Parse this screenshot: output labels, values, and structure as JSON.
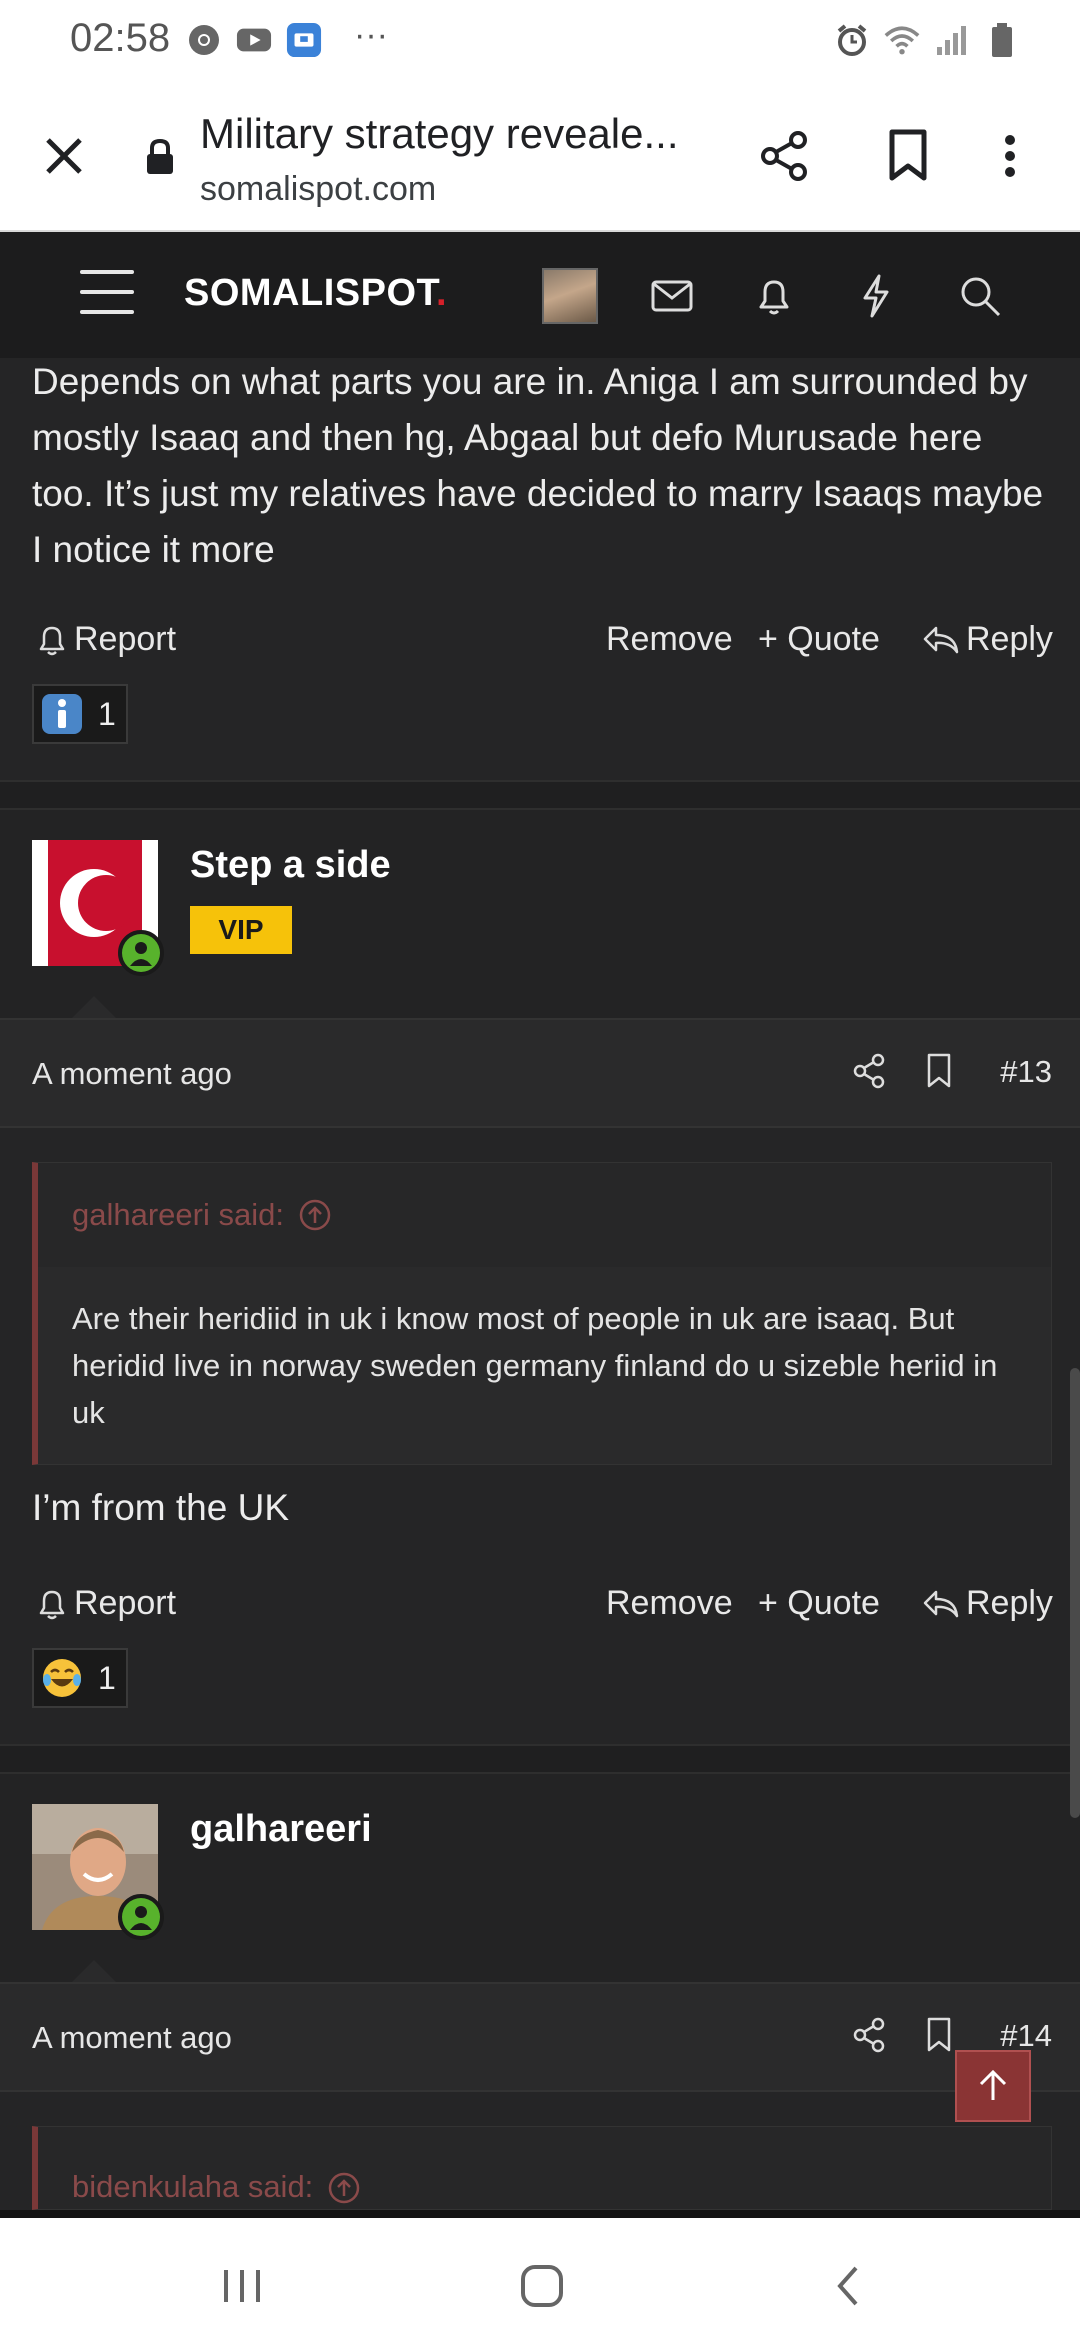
{
  "status_bar": {
    "time": "02:58",
    "more": "···"
  },
  "browser": {
    "title": "Military strategy reveale...",
    "url": "somalispot.com"
  },
  "site": {
    "logo": "SOMALISPOT",
    "logo_dot": "."
  },
  "post12": {
    "text": "Depends on what parts you are in. Aniga I am surrounded by mostly Isaaq and then hg, Abgaal but defo Murusade here too. It’s just my relatives have decided to marry Isaaqs maybe I notice it more",
    "reaction_count": "1"
  },
  "actions": {
    "report": "Report",
    "remove": "Remove",
    "quote": "+ Quote",
    "reply": "Reply"
  },
  "post13": {
    "username": "Step a side",
    "badge": "VIP",
    "time": "A moment ago",
    "number": "#13",
    "quote_author": "galhareeri said:",
    "quote_text": "Are their heridiid in uk i know most of people in uk are isaaq. But heridid live in norway sweden germany finland do u sizeble heriid in uk",
    "text": "I’m from the UK",
    "reaction_count": "1"
  },
  "post14": {
    "username": "galhareeri",
    "time": "A moment ago",
    "number": "#14",
    "quote_author": "bidenkulaha said:"
  },
  "colors": {
    "background": "#252526",
    "accent_red": "#d6202a",
    "vip": "#f6c20a",
    "online": "#58b22c"
  }
}
